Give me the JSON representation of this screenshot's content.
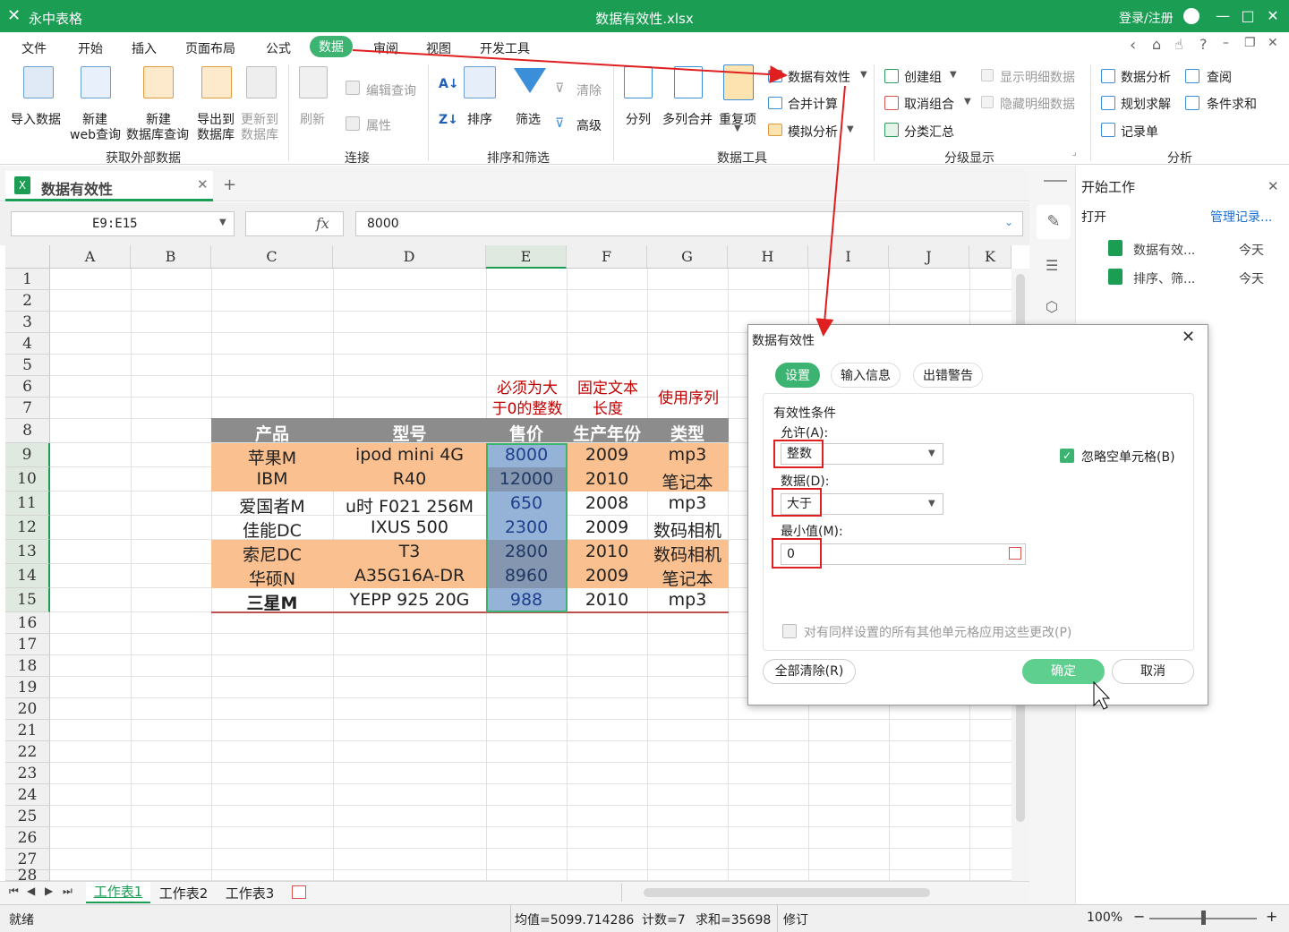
{
  "app": {
    "name": "永中表格",
    "document": "数据有效性.xlsx",
    "login": "登录/注册"
  },
  "menu": [
    "文件",
    "开始",
    "插入",
    "页面布局",
    "公式",
    "数据",
    "审阅",
    "视图",
    "开发工具"
  ],
  "menu_active": "数据",
  "ribbon": {
    "external": {
      "import": "导入数据",
      "new_web_1": "新建",
      "new_web_2": "web查询",
      "new_db_1": "新建",
      "new_db_2": "数据库查询",
      "export_1": "导出到",
      "export_2": "数据库",
      "update_1": "更新到",
      "update_2": "数据库",
      "group": "获取外部数据"
    },
    "connect": {
      "refresh": "刷新",
      "edit_query": "编辑查询",
      "properties": "属性",
      "group": "连接"
    },
    "sort": {
      "sort": "排序",
      "filter": "筛选",
      "clear": "清除",
      "advanced": "高级",
      "group": "排序和筛选"
    },
    "tools": {
      "split": "分列",
      "merge": "多列合并",
      "dup": "重复项",
      "validation": "数据有效性",
      "consolidate": "合并计算",
      "whatif": "模拟分析",
      "group": "数据工具"
    },
    "outline": {
      "group_create": "创建组",
      "ungroup": "取消组合",
      "subtotal": "分类汇总",
      "show_detail": "显示明细数据",
      "hide_detail": "隐藏明细数据",
      "group": "分级显示"
    },
    "analysis": {
      "analysis": "数据分析",
      "solver": "规划求解",
      "record": "记录单",
      "lookup": "查阅",
      "sumif": "条件求和",
      "group": "分析"
    }
  },
  "doc_tab": "数据有效性",
  "formula": {
    "namebox": "E9:E15",
    "fx": "fx",
    "value": "8000"
  },
  "columns": [
    "A",
    "B",
    "C",
    "D",
    "E",
    "F",
    "G",
    "H",
    "I",
    "J",
    "K"
  ],
  "rows": [
    "1",
    "2",
    "3",
    "4",
    "5",
    "6",
    "7",
    "8",
    "9",
    "10",
    "11",
    "12",
    "13",
    "14",
    "15",
    "16",
    "17",
    "18",
    "19",
    "20",
    "21",
    "22",
    "23",
    "24",
    "25",
    "26",
    "27",
    "28"
  ],
  "notes": {
    "e": [
      "必须为大",
      "于0的整数"
    ],
    "f": [
      "固定文本",
      "长度"
    ],
    "g": "使用序列"
  },
  "table": {
    "headers": [
      "产品",
      "型号",
      "售价",
      "生产年份",
      "类型"
    ],
    "rows": [
      [
        "苹果M",
        "ipod mini 4G",
        "8000",
        "2009",
        "mp3"
      ],
      [
        "IBM",
        "R40",
        "12000",
        "2010",
        "笔记本"
      ],
      [
        "爱国者M",
        "u时 F021 256M",
        "650",
        "2008",
        "mp3"
      ],
      [
        "佳能DC",
        "IXUS 500",
        "2300",
        "2009",
        "数码相机"
      ],
      [
        "索尼DC",
        "T3",
        "2800",
        "2010",
        "数码相机"
      ],
      [
        "华硕N",
        "A35G16A-DR",
        "8960",
        "2009",
        "笔记本"
      ],
      [
        "三星M",
        "YEPP 925 20G",
        "988",
        "2010",
        "mp3"
      ]
    ]
  },
  "sheets": [
    "工作表1",
    "工作表2",
    "工作表3"
  ],
  "status": {
    "ready": "就绪",
    "avg": "均值=5099.714286",
    "count": "计数=7",
    "sum": "求和=35698",
    "revise": "修订",
    "zoom": "100%"
  },
  "side": {
    "title": "开始工作",
    "open": "打开",
    "manage": "管理记录...",
    "files": [
      {
        "name": "数据有效...",
        "time": "今天"
      },
      {
        "name": "排序、筛...",
        "time": "今天"
      }
    ]
  },
  "dialog": {
    "title": "数据有效性",
    "tabs": [
      "设置",
      "输入信息",
      "出错警告"
    ],
    "section": "有效性条件",
    "allow_label": "允许(A):",
    "allow_value": "整数",
    "ignore_blank": "忽略空单元格(B)",
    "data_label": "数据(D):",
    "data_value": "大于",
    "min_label": "最小值(M):",
    "min_value": "0",
    "apply_all": "对有同样设置的所有其他单元格应用这些更改(P)",
    "clear_all": "全部清除(R)",
    "ok": "确定",
    "cancel": "取消"
  },
  "colors": {
    "brand": "#1b9d54",
    "header_gray": "#8c8c8c",
    "orange": "#fac08f",
    "blue": "#95b3d7",
    "note_red": "#c00000",
    "arrow_red": "#e02020"
  }
}
